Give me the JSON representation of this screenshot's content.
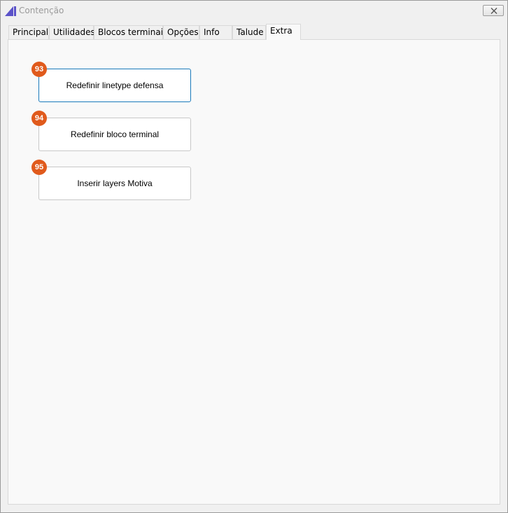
{
  "window": {
    "title": "Contenção",
    "close_icon": "close-icon",
    "app_icon": "app-logo-icon",
    "accent_color": "#6a5acd"
  },
  "tabs": [
    {
      "label": "Principal"
    },
    {
      "label": "Utilidades"
    },
    {
      "label": "Blocos terminais"
    },
    {
      "label": "Opções"
    },
    {
      "label": "Info"
    },
    {
      "label": "Talude"
    },
    {
      "label": "Extra",
      "active": true
    }
  ],
  "extra": {
    "buttons": [
      {
        "badge": "93",
        "label": "Redefinir linetype defensa"
      },
      {
        "badge": "94",
        "label": "Redefinir bloco terminal"
      },
      {
        "badge": "95",
        "label": "Inserir layers Motiva"
      }
    ]
  },
  "colors": {
    "badge": "#e05a1c",
    "focus_border": "#1979ba"
  }
}
